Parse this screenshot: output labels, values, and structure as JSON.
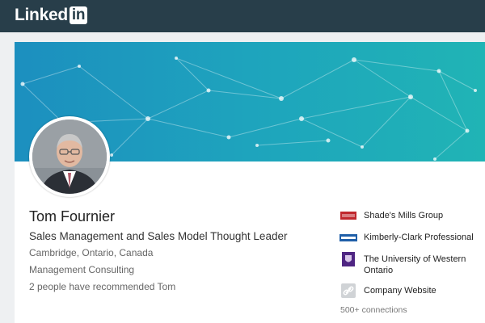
{
  "header": {
    "logo_text": "Linked",
    "logo_in": "in"
  },
  "profile": {
    "name": "Tom Fournier",
    "headline": "Sales Management and Sales Model Thought Leader",
    "location": "Cambridge, Ontario, Canada",
    "industry": "Management Consulting",
    "recommendations": "2 people have recommended Tom"
  },
  "sidebar": {
    "items": [
      {
        "label": "Shade's Mills Group",
        "icon": "shades-mills-logo-icon"
      },
      {
        "label": "Kimberly-Clark Professional",
        "icon": "kimberly-clark-logo-icon"
      },
      {
        "label": "The University of Western Ontario",
        "icon": "western-ontario-crest-icon"
      },
      {
        "label": "Company Website",
        "icon": "link-icon"
      }
    ],
    "connections": "500+ connections"
  },
  "colors": {
    "topbar": "#283e4a",
    "banner_start": "#1c8fbf",
    "banner_end": "#20b4b5"
  }
}
